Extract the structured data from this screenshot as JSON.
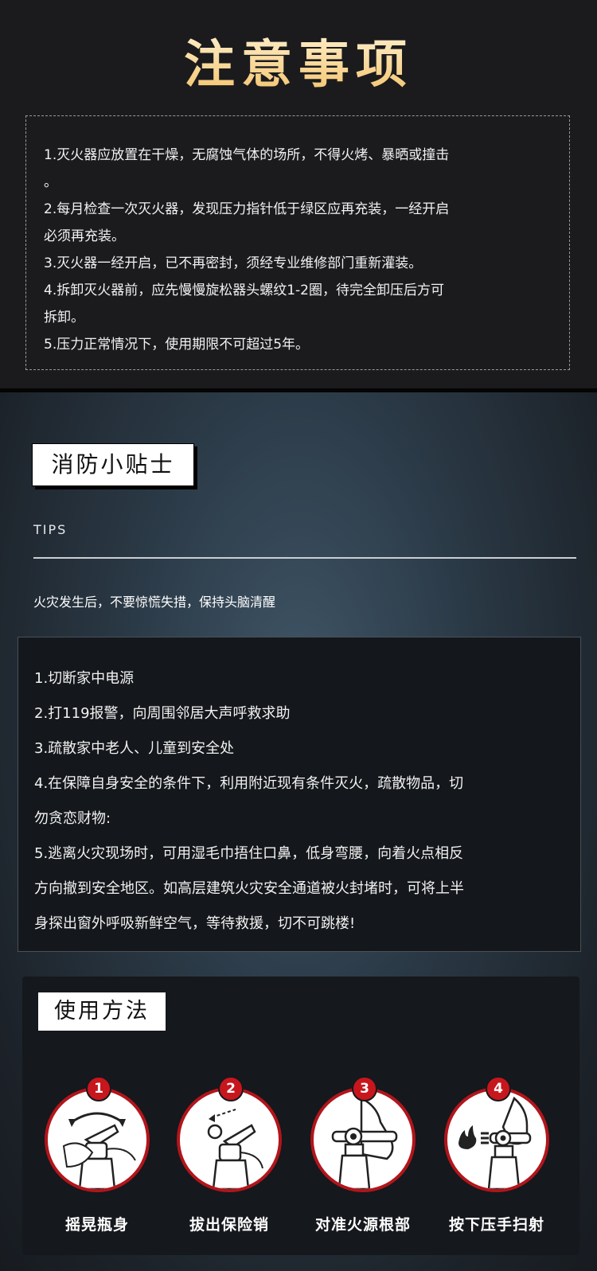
{
  "notice": {
    "title": "注意事项",
    "items": [
      "1.灭火器应放置在干燥，无腐蚀气体的场所，不得火烤、暴晒或撞击",
      "。",
      "2.每月检查一次灭火器，发现压力指针低于绿区应再充装，一经开启",
      "必须再充装。",
      "3.灭火器一经开启，已不再密封，须经专业维修部门重新灌装。",
      "4.拆卸灭火器前，应先慢慢旋松器头螺纹1-2圈，待完全卸压后方可",
      "拆卸。",
      "5.压力正常情况下，使用期限不可超过5年。"
    ]
  },
  "tips": {
    "label": "消防小贴士",
    "english": "TIPS",
    "subtitle": "火灾发生后，不要惊慌失措，保持头脑清醒",
    "lines": [
      "1.切断家中电源",
      "2.打119报警，向周围邻居大声呼救求助",
      "3.疏散家中老人、儿童到安全处",
      "4.在保障自身安全的条件下，利用附近现有条件灭火，疏散物品，切",
      "勿贪恋财物:",
      "5.逃离火灾现场时，可用湿毛巾捂住口鼻，低身弯腰，向着火点相反",
      "方向撤到安全地区。如高层建筑火灾安全通道被火封堵时，可将上半",
      "身探出窗外呼吸新鲜空气，等待救援，切不可跳楼!"
    ]
  },
  "usage": {
    "label": "使用方法",
    "accent": "#c8161d",
    "steps": [
      {
        "number": "1",
        "caption": "摇晃瓶身",
        "icon": "shake-extinguisher-icon"
      },
      {
        "number": "2",
        "caption": "拔出保险销",
        "icon": "pull-pin-icon"
      },
      {
        "number": "3",
        "caption": "对准火源根部",
        "icon": "aim-nozzle-icon"
      },
      {
        "number": "4",
        "caption": "按下压手扫射",
        "icon": "squeeze-handle-icon"
      }
    ]
  }
}
